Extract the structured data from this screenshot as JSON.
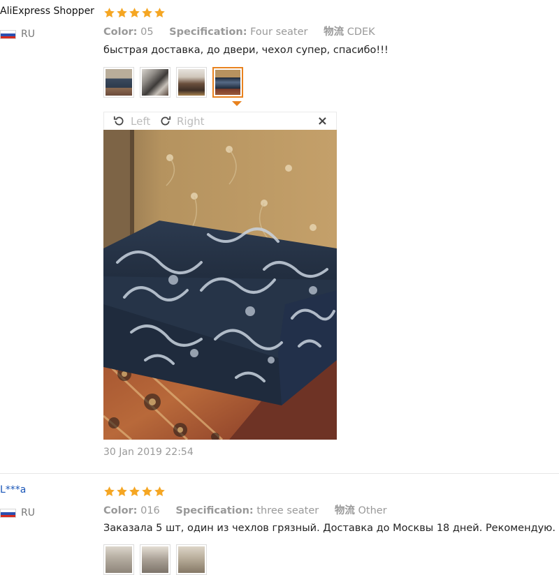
{
  "reviews": [
    {
      "user": "AliExpress Shopper",
      "country": "RU",
      "rating": 5,
      "meta": [
        {
          "label": "Color:",
          "value": "05"
        },
        {
          "label": "Specification:",
          "value": "Four seater"
        },
        {
          "label": "物流",
          "value": "CDEK"
        }
      ],
      "text": "быстрая доставка, до двери, чехол супер, спасибо!!!",
      "viewer": {
        "rotate_left": "Left",
        "rotate_right": "Right",
        "close": "×"
      },
      "date": "30 Jan 2019 22:54"
    },
    {
      "user": "L***a",
      "country": "RU",
      "rating": 5,
      "meta": [
        {
          "label": "Color:",
          "value": "016"
        },
        {
          "label": "Specification:",
          "value": "three seater"
        },
        {
          "label": "物流",
          "value": "Other"
        }
      ],
      "text": "Заказала 5 шт, один из чехлов грязный. Доставка до Москвы 18 дней. Рекомендую."
    }
  ],
  "colors": {
    "star": "#f5a623",
    "accent": "#e8821e",
    "link": "#1a56b8"
  }
}
